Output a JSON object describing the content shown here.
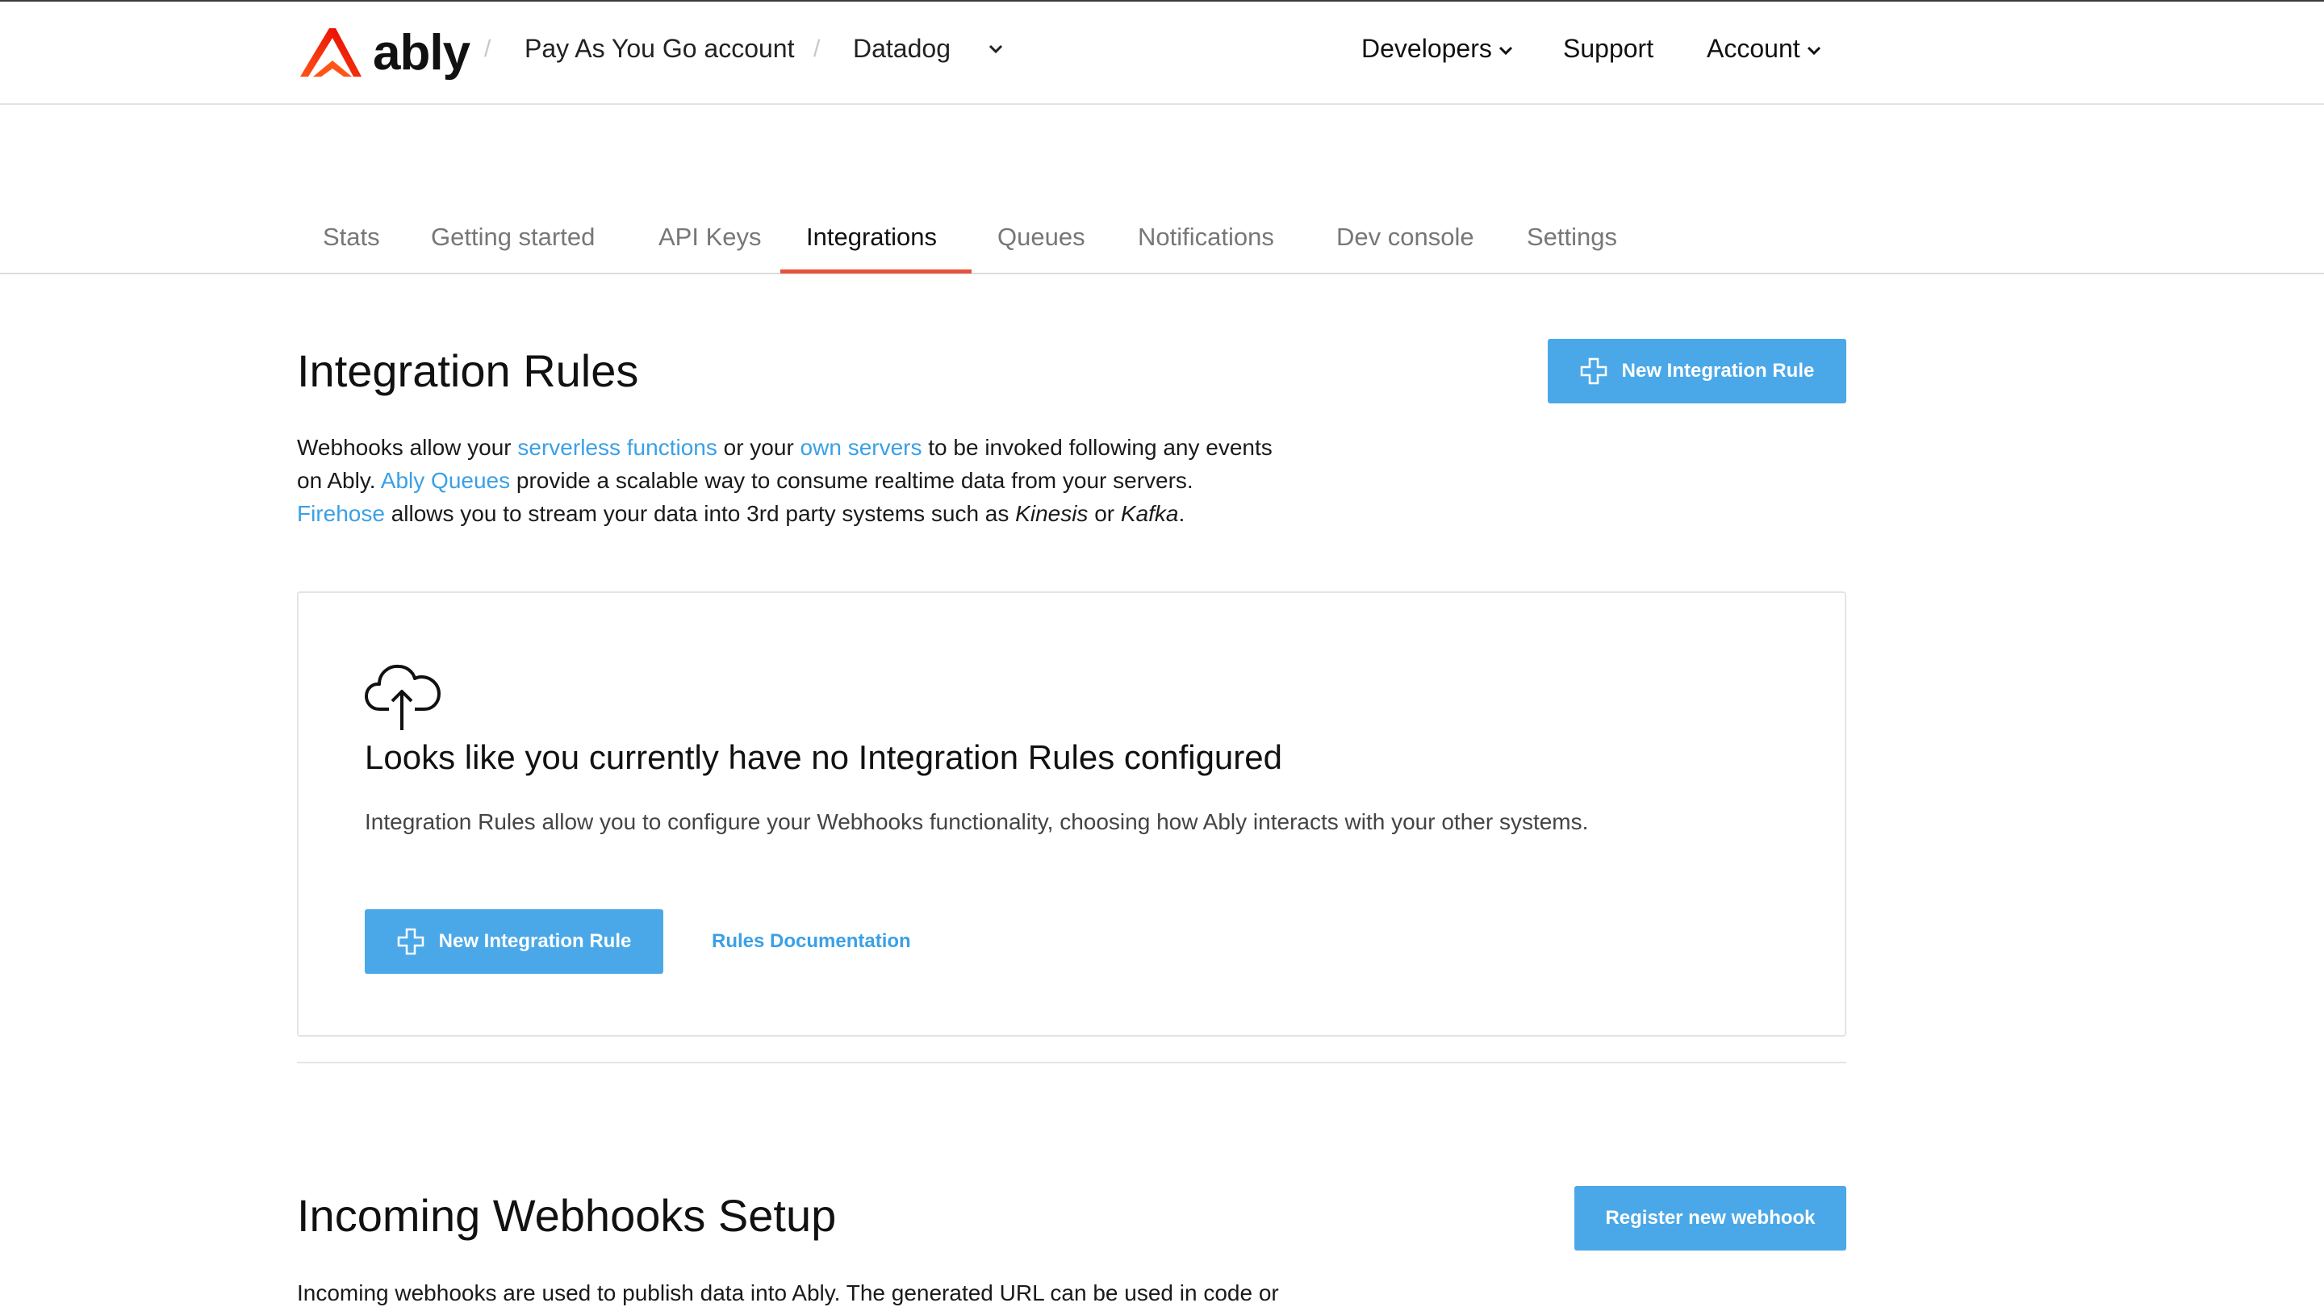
{
  "header": {
    "logo_text": "ably",
    "breadcrumb": [
      {
        "label": "Pay As You Go account"
      },
      {
        "label": "Datadog"
      }
    ],
    "nav": {
      "developers": "Developers",
      "support": "Support",
      "account": "Account"
    }
  },
  "tabs": [
    {
      "label": "Stats"
    },
    {
      "label": "Getting started"
    },
    {
      "label": "API Keys"
    },
    {
      "label": "Integrations",
      "active": true
    },
    {
      "label": "Queues"
    },
    {
      "label": "Notifications"
    },
    {
      "label": "Dev console"
    },
    {
      "label": "Settings"
    }
  ],
  "integration_rules": {
    "title": "Integration Rules",
    "new_rule_button": "New Integration Rule",
    "intro": {
      "t1": "Webhooks allow your ",
      "link1": "serverless functions",
      "t2": " or your ",
      "link2": "own servers",
      "t3": " to be invoked following any events",
      "t4": "on Ably. ",
      "link3": "Ably Queues",
      "t5": " provide a scalable way to consume realtime data from your servers.",
      "link4": "Firehose",
      "t6": " allows you to stream your data into 3rd party systems such as ",
      "em1": "Kinesis",
      "t7": " or ",
      "em2": "Kafka",
      "t8": "."
    },
    "empty_state": {
      "title": "Looks like you currently have no Integration Rules configured",
      "description": "Integration Rules allow you to configure your Webhooks functionality, choosing how Ably interacts with your other systems.",
      "button": "New Integration Rule",
      "docs_link": "Rules Documentation"
    }
  },
  "incoming_webhooks": {
    "title": "Incoming Webhooks Setup",
    "register_button": "Register new webhook",
    "intro": "Incoming webhooks are used to publish data into Ably. The generated URL can be used in code or"
  },
  "colors": {
    "accent": "#4aa8e8",
    "link": "#3aa0e6",
    "tab_active_underline": "#e8513d",
    "brand": "#ff5416"
  }
}
